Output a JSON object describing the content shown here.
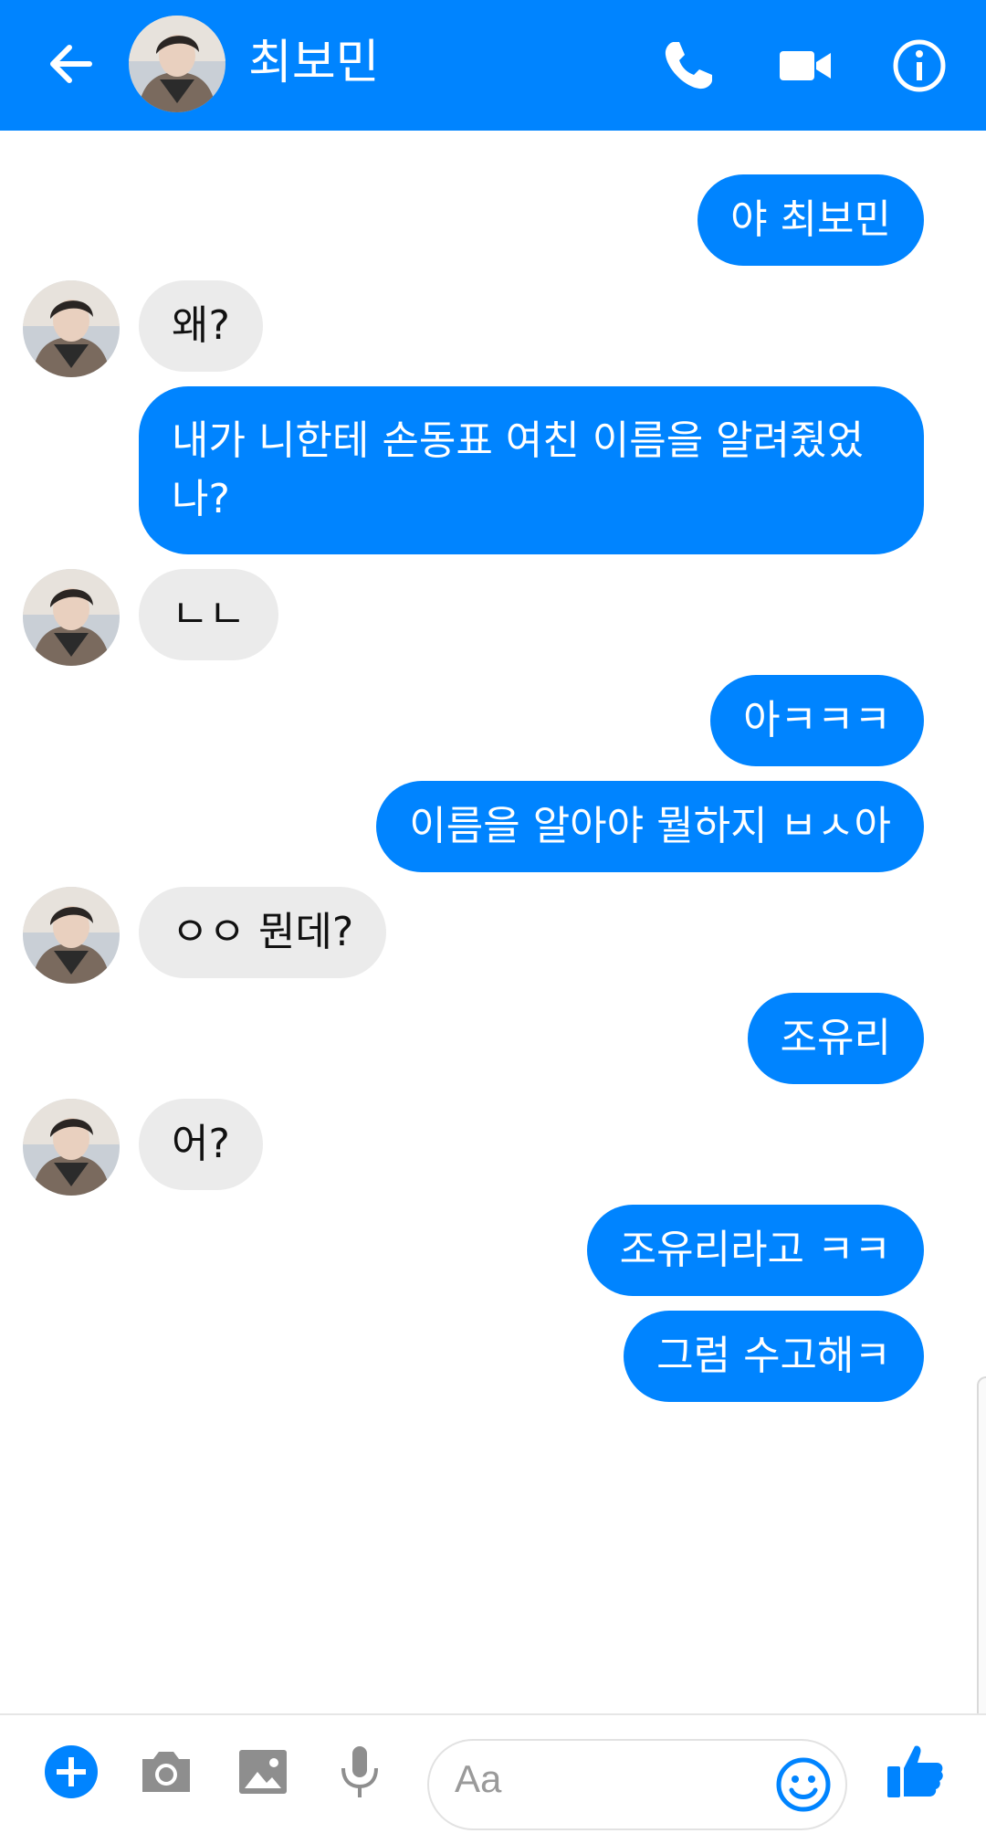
{
  "header": {
    "title": "최보민",
    "back_icon": "arrow-left-icon",
    "call_icon": "phone-icon",
    "video_icon": "video-camera-icon",
    "info_icon": "info-icon",
    "color": "#0084ff"
  },
  "messages": [
    {
      "from": "me",
      "text": "야 최보민"
    },
    {
      "from": "them",
      "text": "왜?"
    },
    {
      "from": "me",
      "text": "내가 니한테 손동표 여친 이름을 알려줬었나?"
    },
    {
      "from": "them",
      "text": "ㄴㄴ"
    },
    {
      "from": "me",
      "text": "아ㅋㅋㅋ"
    },
    {
      "from": "me",
      "text": "이름을 알아야 뭘하지 ㅂㅅ아"
    },
    {
      "from": "them",
      "text": "ㅇㅇ 뭔데?"
    },
    {
      "from": "me",
      "text": "조유리"
    },
    {
      "from": "them",
      "text": "어?"
    },
    {
      "from": "me",
      "text": "조유리라고 ㅋㅋ"
    },
    {
      "from": "me",
      "text": "그럼 수고해ㅋ"
    }
  ],
  "composer": {
    "placeholder": "Aa",
    "icons": [
      "plus-icon",
      "camera-icon",
      "image-icon",
      "microphone-icon",
      "emoji-icon",
      "thumbs-up-icon"
    ]
  },
  "colors": {
    "outgoing_bubble": "#0084ff",
    "incoming_bubble": "#ebebeb",
    "accent": "#0084ff"
  }
}
